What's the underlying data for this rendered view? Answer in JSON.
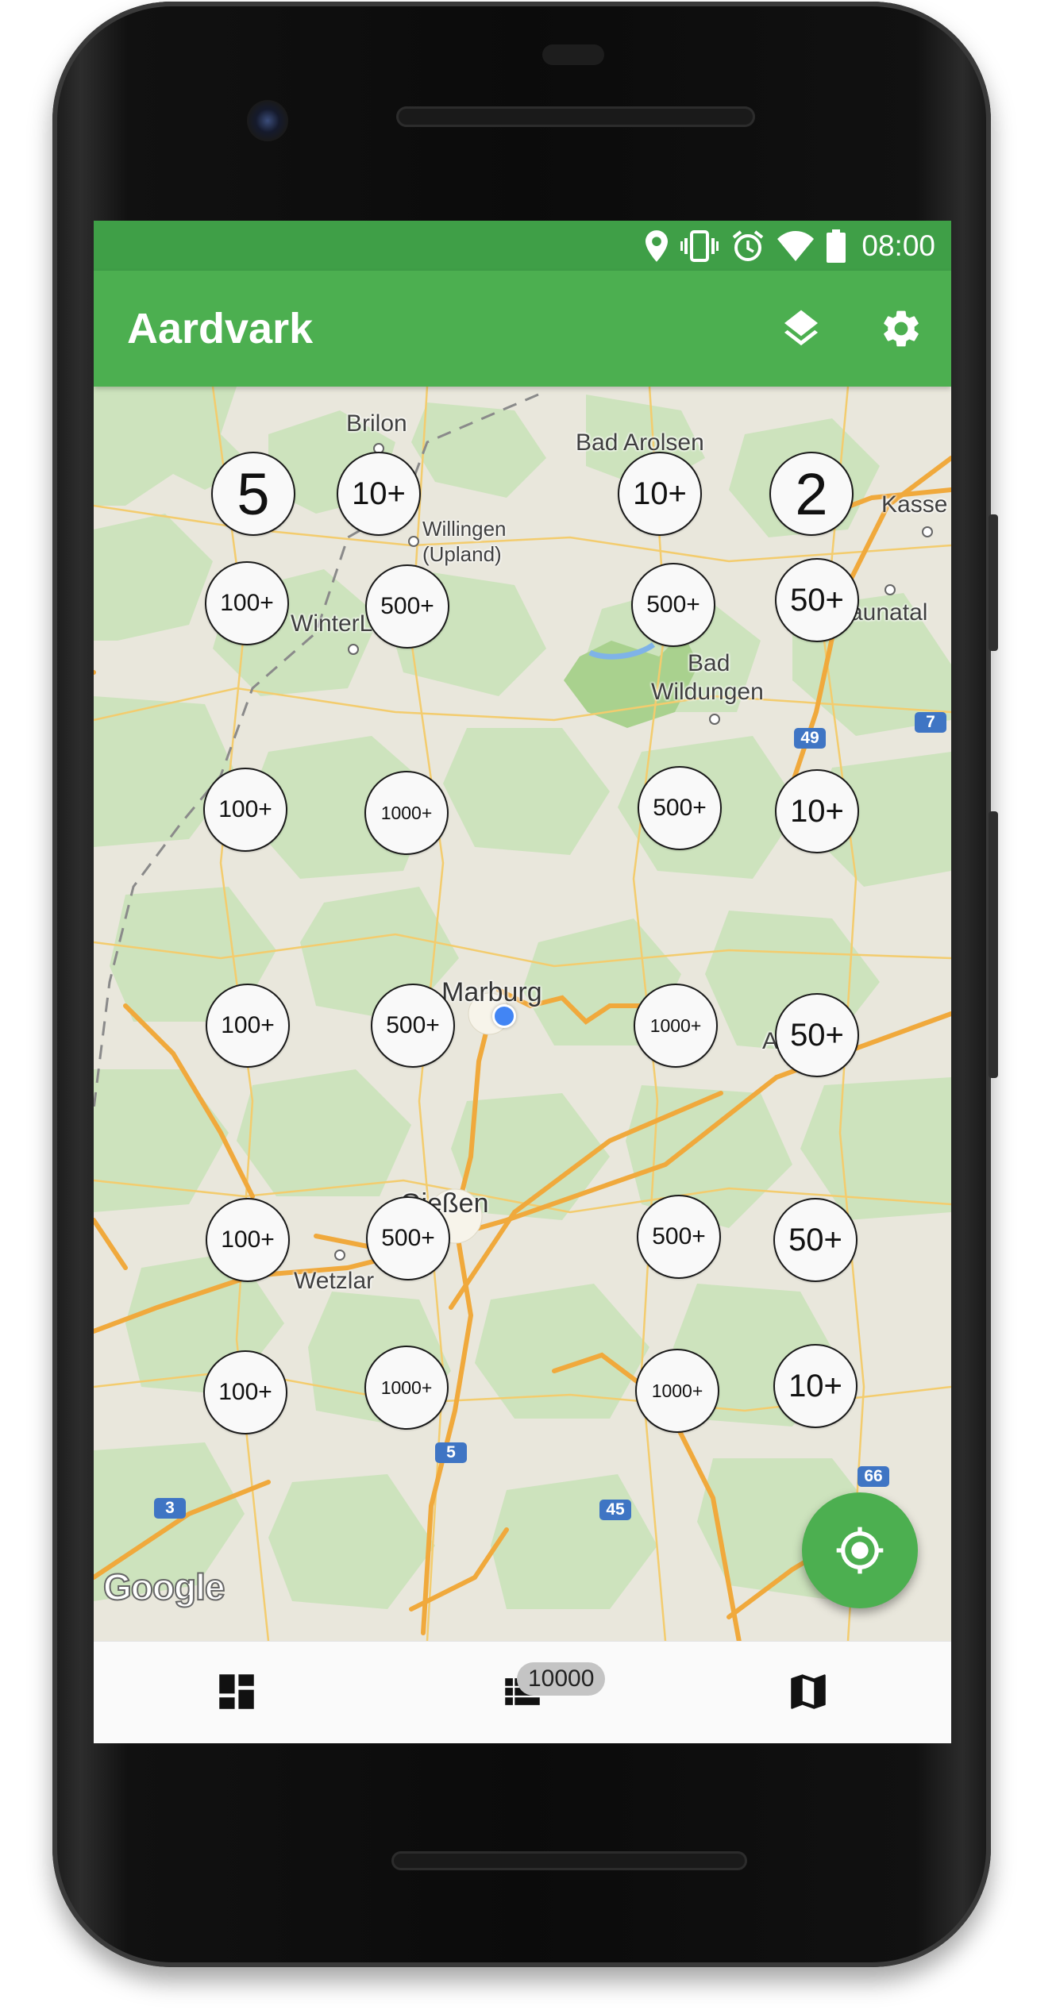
{
  "status_bar": {
    "time": "08:00",
    "icons": [
      "location-icon",
      "vibrate-icon",
      "alarm-icon",
      "wifi-icon",
      "battery-icon"
    ]
  },
  "app_bar": {
    "title": "Aardvark",
    "actions": [
      "layers-icon",
      "settings-gear-icon"
    ]
  },
  "map": {
    "places": {
      "brilon": "Brilon",
      "bad_arolsen": "Bad Arolsen",
      "kassel": "Kasse",
      "willingen": "Willingen",
      "upland": "(Upland)",
      "winterberg": "WinterL",
      "baunatal": "aunatal",
      "bad": "Bad",
      "wildungen": "Wildungen",
      "marburg": "Marburg",
      "giessen": "Gießen",
      "wetzlar": "Wetzlar",
      "a_fragment": "A"
    },
    "road_shields": {
      "r49": "49",
      "r7": "7",
      "r5": "5",
      "r3": "3",
      "r45": "45",
      "r66": "66"
    },
    "clusters": [
      {
        "label": "5"
      },
      {
        "label": "10+"
      },
      {
        "label": "10+"
      },
      {
        "label": "2"
      },
      {
        "label": "100+"
      },
      {
        "label": "500+"
      },
      {
        "label": "500+"
      },
      {
        "label": "50+"
      },
      {
        "label": "100+"
      },
      {
        "label": "1000+"
      },
      {
        "label": "500+"
      },
      {
        "label": "10+"
      },
      {
        "label": "100+"
      },
      {
        "label": "500+"
      },
      {
        "label": "1000+"
      },
      {
        "label": "50+"
      },
      {
        "label": "100+"
      },
      {
        "label": "500+"
      },
      {
        "label": "500+"
      },
      {
        "label": "50+"
      },
      {
        "label": "100+"
      },
      {
        "label": "1000+"
      },
      {
        "label": "1000+"
      },
      {
        "label": "10+"
      }
    ],
    "attribution": "Google"
  },
  "fab": {
    "icon": "my-location-icon"
  },
  "bottom_nav": {
    "items": [
      {
        "icon": "dashboard-icon"
      },
      {
        "icon": "list-icon",
        "badge": "10000"
      },
      {
        "icon": "map-icon"
      }
    ]
  }
}
